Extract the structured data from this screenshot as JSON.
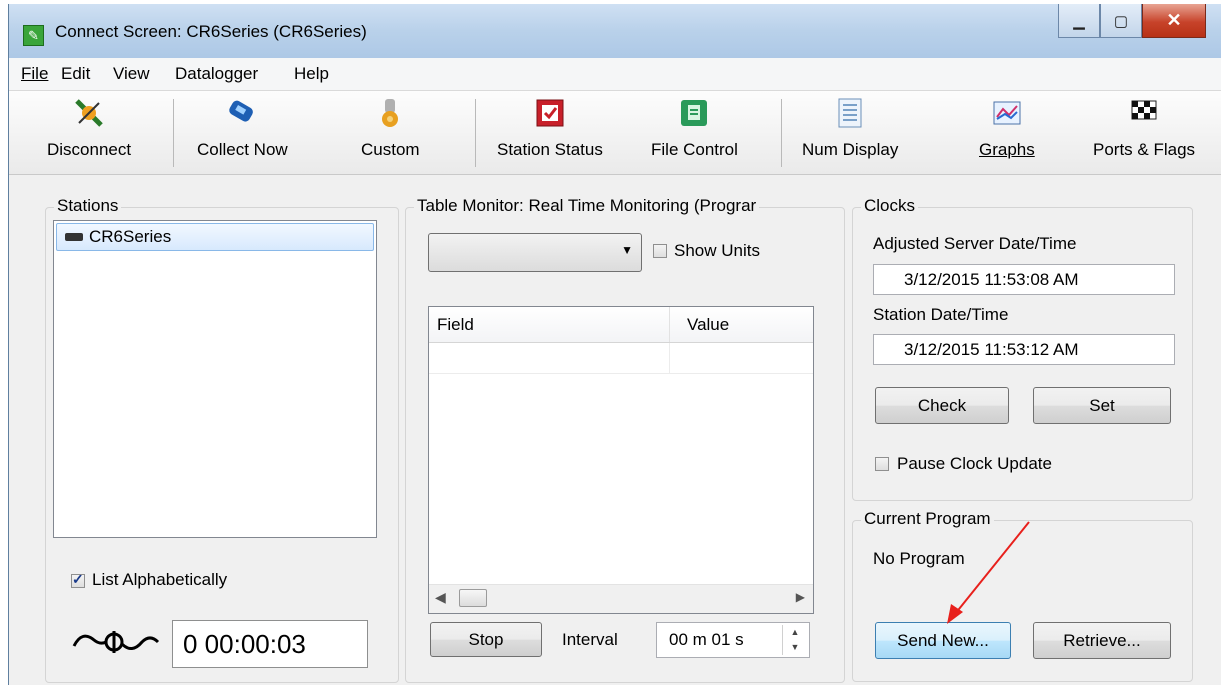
{
  "window": {
    "title": "Connect Screen: CR6Series (CR6Series)",
    "minimize": "▁",
    "maximize": "▢",
    "close": "✕"
  },
  "menu": [
    "File",
    "Edit",
    "View",
    "Datalogger",
    "Help"
  ],
  "toolbar": [
    {
      "label": "Disconnect",
      "icon": "disconnect-plug-icon"
    },
    {
      "label": "Collect Now",
      "icon": "phone-collect-icon"
    },
    {
      "label": "Custom",
      "icon": "custom-gear-icon"
    },
    {
      "label": "Station Status",
      "icon": "station-status-icon"
    },
    {
      "label": "File Control",
      "icon": "file-control-icon"
    },
    {
      "label": "Num Display",
      "icon": "num-display-icon"
    },
    {
      "label": "Graphs",
      "icon": "graphs-icon"
    },
    {
      "label": "Ports & Flags",
      "icon": "checkered-flag-icon"
    }
  ],
  "stations": {
    "label": "Stations",
    "items": [
      "CR6Series"
    ],
    "list_alphabetically": "List Alphabetically",
    "timer": "0 00:00:03"
  },
  "table_monitor": {
    "label": "Table Monitor: Real Time Monitoring (Prograr",
    "show_units": "Show Units",
    "field_header": "Field",
    "value_header": "Value",
    "stop": "Stop",
    "interval_label": "Interval",
    "interval_value": "00 m 01 s"
  },
  "clocks": {
    "label": "Clocks",
    "server_label": "Adjusted Server Date/Time",
    "server_value": "3/12/2015 11:53:08 AM",
    "station_label": "Station Date/Time",
    "station_value": "3/12/2015 11:53:12 AM",
    "check": "Check",
    "set": "Set",
    "pause": "Pause Clock Update"
  },
  "current_program": {
    "label": "Current Program",
    "value": "No Program",
    "send_new": "Send New...",
    "retrieve": "Retrieve..."
  },
  "colors": {
    "annotation_arrow": "#e8201c",
    "title_bar": "#b9d1ea",
    "selection": "#d7e9fd"
  }
}
